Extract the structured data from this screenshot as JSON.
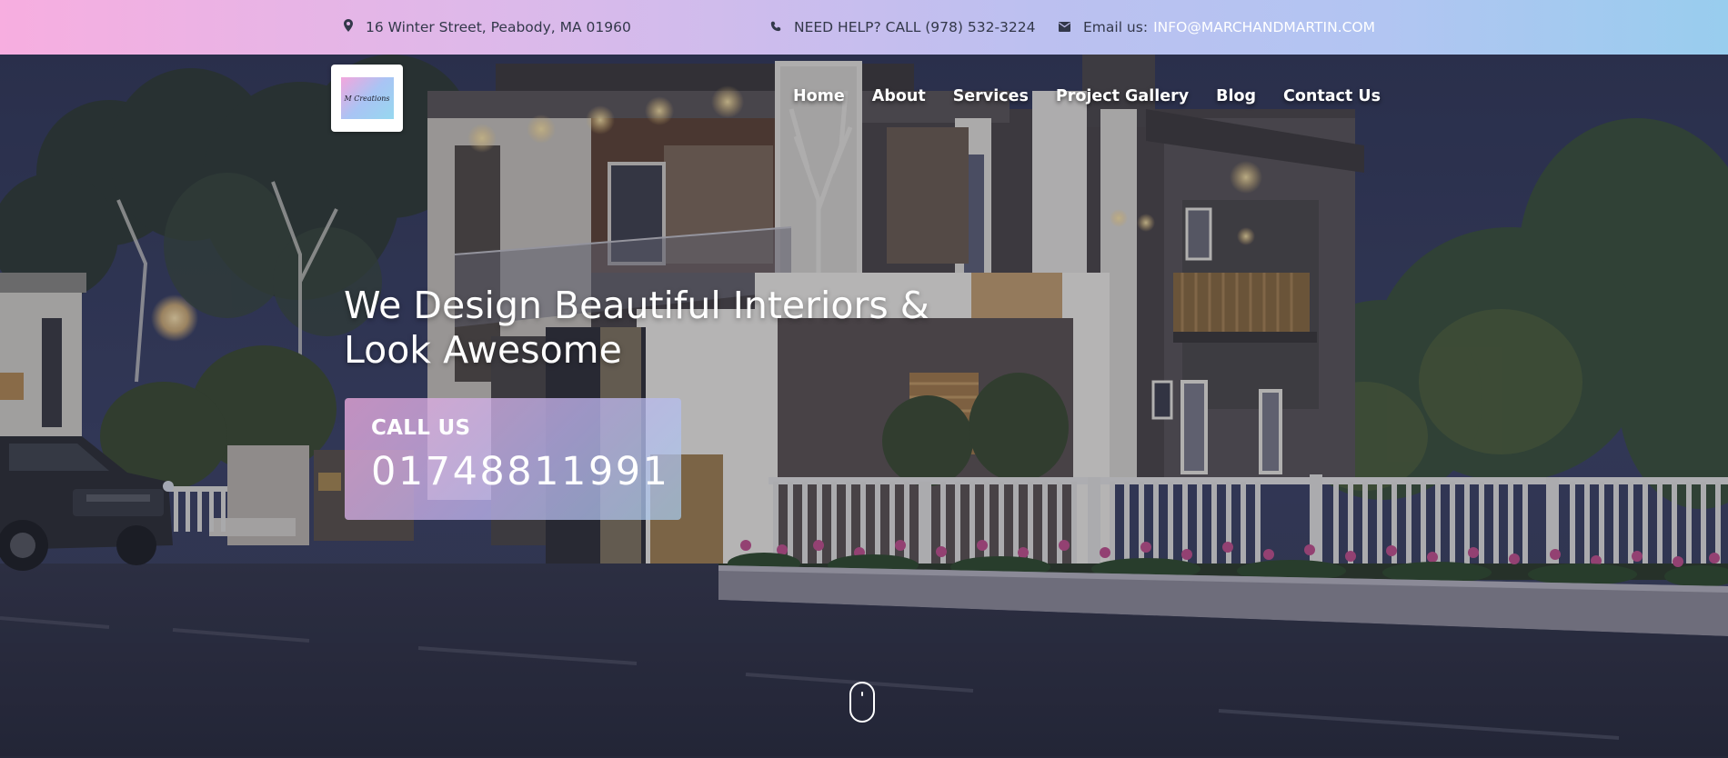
{
  "topbar": {
    "address": "16 Winter Street, Peabody, MA 01960",
    "address_icon": "map-marker-icon",
    "help_text": "NEED HELP? CALL (978) 532-3224",
    "help_icon": "phone-icon",
    "email_label": "Email us:",
    "email_value": "INFO@MARCHANDMARTIN.COM",
    "email_icon": "envelope-icon"
  },
  "logo": {
    "text": "M Creations"
  },
  "nav": {
    "items": [
      {
        "label": "Home"
      },
      {
        "label": "About"
      },
      {
        "label": "Services"
      },
      {
        "label": "Project Gallery"
      },
      {
        "label": "Blog"
      },
      {
        "label": "Contact Us"
      }
    ]
  },
  "hero": {
    "headline_line1": "We Design Beautiful Interiors &",
    "headline_line2": "Look Awesome",
    "call_label": "CALL US",
    "call_number": "01748811991",
    "scroll_icon": "mouse-scroll-icon"
  },
  "colors": {
    "topbar_gradient_start": "#f7aee0",
    "topbar_gradient_end": "#98cdee",
    "callbox_tint": "#c8b2ec",
    "nav_text": "#ffffff"
  }
}
